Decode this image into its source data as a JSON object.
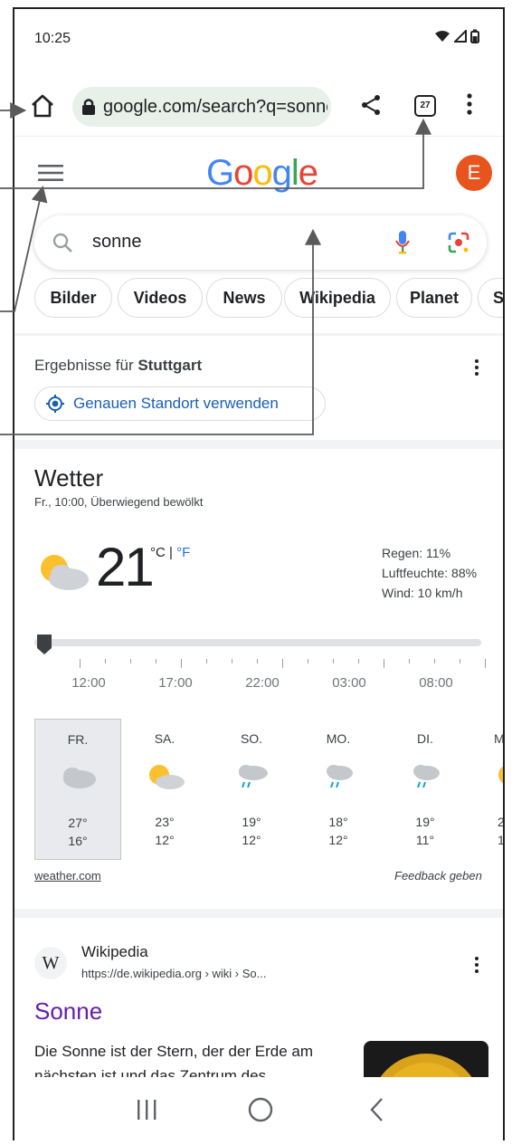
{
  "status_bar": {
    "time": "10:25"
  },
  "browser": {
    "url": "google.com/search?q=sonne",
    "tab_count": "27"
  },
  "google": {
    "logo_letters": [
      {
        "ch": "G",
        "color": "#4285f4"
      },
      {
        "ch": "o",
        "color": "#ea4335"
      },
      {
        "ch": "o",
        "color": "#fbbc05"
      },
      {
        "ch": "g",
        "color": "#4285f4"
      },
      {
        "ch": "l",
        "color": "#34a853"
      },
      {
        "ch": "e",
        "color": "#ea4335"
      }
    ],
    "avatar_letter": "E",
    "search_query": "sonne"
  },
  "chips": [
    "Bilder",
    "Videos",
    "News",
    "Wikipedia",
    "Planet",
    "St"
  ],
  "location": {
    "prefix": "Ergebnisse für ",
    "city": "Stuttgart",
    "button_label": "Genauen Standort verwenden"
  },
  "weather": {
    "title": "Wetter",
    "subtitle": "Fr., 10:00, Überwiegend bewölkt",
    "temperature": "21",
    "unit_c": "°C",
    "unit_sep": " | ",
    "unit_f": "°F",
    "details": [
      "Regen: 11%",
      "Luftfeuchte: 88%",
      "Wind: 10 km/h"
    ],
    "hours": [
      "12:00",
      "17:00",
      "22:00",
      "03:00",
      "08:00"
    ],
    "days": [
      {
        "name": "FR.",
        "icon": "cloudy-icon",
        "hi": "27°",
        "lo": "16°"
      },
      {
        "name": "SA.",
        "icon": "partly-sunny-icon",
        "hi": "23°",
        "lo": "12°"
      },
      {
        "name": "SO.",
        "icon": "rain-icon",
        "hi": "19°",
        "lo": "12°"
      },
      {
        "name": "MO.",
        "icon": "rain-icon",
        "hi": "18°",
        "lo": "12°"
      },
      {
        "name": "DI.",
        "icon": "rain-icon",
        "hi": "19°",
        "lo": "11°"
      },
      {
        "name": "M",
        "icon": "partly-sunny-icon",
        "hi": "2",
        "lo": "1"
      }
    ],
    "source": "weather.com",
    "feedback": "Feedback geben"
  },
  "wiki": {
    "favicon": "W",
    "site": "Wikipedia",
    "url": "https://de.wikipedia.org › wiki › So...",
    "title": "Sonne",
    "snippet": "Die Sonne ist der Stern, der der Erde am nächsten ist und das Zentrum des"
  },
  "colors": {
    "accent_blue": "#1a5fb4",
    "link_purple": "#681da8",
    "avatar": "#e8541e",
    "url_pill": "#e8f0ea"
  }
}
